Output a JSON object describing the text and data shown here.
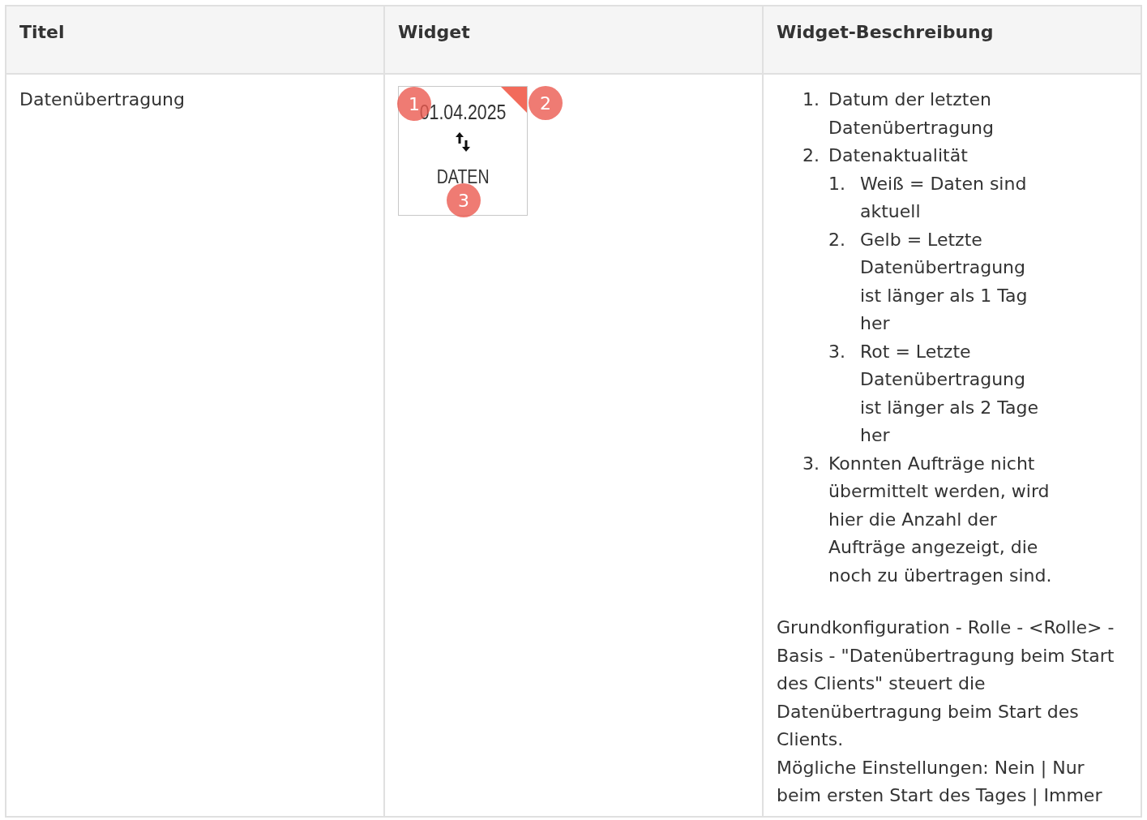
{
  "table": {
    "columns": [
      "Titel",
      "Widget",
      "Widget-Beschreibung"
    ],
    "rows": [
      {
        "title": "Datenübertragung",
        "widget": {
          "date": "01.04.2025",
          "label": "DATEN",
          "callouts": [
            "1",
            "2",
            "3"
          ]
        },
        "description": {
          "list": [
            {
              "number": "1.",
              "text": "Datum der letzten Datenübertragung"
            },
            {
              "number": "2.",
              "text": "Datenaktualität",
              "children": [
                {
                  "number": "1.",
                  "text": "Weiß = Daten sind aktuell"
                },
                {
                  "number": "2.",
                  "text": "Gelb = Letzte Datenübertragung ist länger als 1 Tag her"
                },
                {
                  "number": "3.",
                  "text": "Rot = Letzte Datenübertragung ist länger als 2 Tage her"
                }
              ]
            },
            {
              "number": "3.",
              "text": "Konnten Aufträge nicht übermittelt werden, wird hier die Anzahl der Aufträge angezeigt, die noch zu übertragen sind."
            }
          ],
          "paragraphs": [
            "Grundkonfiguration - Rolle - <Rolle> - Basis - \"Datenübertragung beim Start des Clients\" steuert die Datenübertragung beim Start des Clients.",
            "Mögliche Einstellungen: Nein | Nur beim ersten Start des Tages | Immer"
          ]
        }
      }
    ]
  }
}
